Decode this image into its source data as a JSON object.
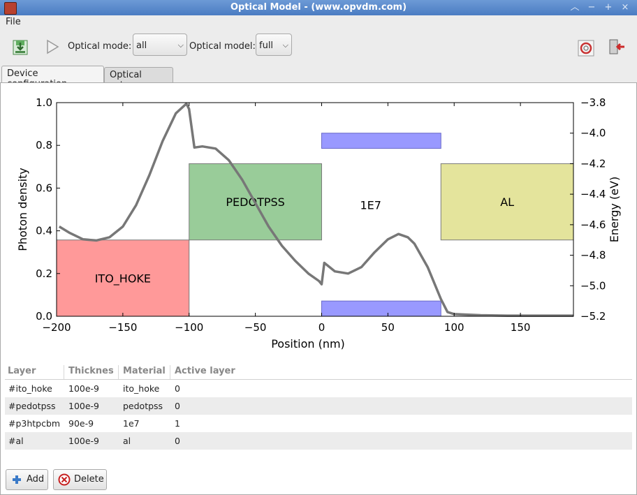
{
  "window": {
    "title": "Optical Model - (www.opvdm.com)"
  },
  "menu": {
    "file": "File"
  },
  "toolbar": {
    "optical_mode_label": "Optical mode:",
    "optical_mode_value": "all",
    "optical_model_label": "Optical model:",
    "optical_model_value": "full"
  },
  "tabs": [
    "Device configuration",
    "Optical setup"
  ],
  "chart_data": {
    "type": "line",
    "xlabel": "Position (nm)",
    "ylabel": "Photon density",
    "y2label": "Energy (eV)",
    "xlim": [
      -200,
      190
    ],
    "ylim": [
      0,
      1.0
    ],
    "y2lim": [
      -5.2,
      -3.8
    ],
    "xticks": [
      -200,
      -150,
      -100,
      -50,
      0,
      50,
      100,
      150
    ],
    "xtick_labels": [
      "−200",
      "−150",
      "−100",
      "−50",
      "0",
      "50",
      "100",
      "150"
    ],
    "yticks": [
      0.0,
      0.2,
      0.4,
      0.6,
      0.8,
      1.0
    ],
    "ytick_labels": [
      "0.0",
      "0.2",
      "0.4",
      "0.6",
      "0.8",
      "1.0"
    ],
    "y2ticks": [
      -5.2,
      -5.0,
      -4.8,
      -4.6,
      -4.4,
      -4.2,
      -4.0,
      -3.8
    ],
    "y2tick_labels": [
      "−5.2",
      "−5.0",
      "−4.8",
      "−4.6",
      "−4.4",
      "−4.2",
      "−4.0",
      "−3.8"
    ],
    "layers": [
      {
        "name": "ITO_HOKE",
        "x0": -200,
        "x1": -100,
        "e_top": -4.7,
        "e_bottom": -5.2,
        "color": "#ff9999"
      },
      {
        "name": "PEDOTPSS",
        "x0": -100,
        "x1": 0,
        "e_top": -4.2,
        "e_bottom": -4.7,
        "color": "#99cc99"
      },
      {
        "name": "AL",
        "x0": 90,
        "x1": 190,
        "e_top": -4.2,
        "e_bottom": -4.7,
        "color": "#e4e49c"
      }
    ],
    "bands": [
      {
        "x0": 0,
        "x1": 90,
        "e_top": -4.0,
        "e_bottom": -4.1,
        "color": "#9999ff"
      },
      {
        "x0": 0,
        "x1": 90,
        "e_top": -5.1,
        "e_bottom": -5.2,
        "color": "#9999ff"
      }
    ],
    "active_label": {
      "text": "1E7",
      "x": 37,
      "e": -4.47
    },
    "series": [
      {
        "color": "#777777",
        "x": [
          -198,
          -190,
          -180,
          -170,
          -160,
          -150,
          -140,
          -130,
          -120,
          -110,
          -102,
          -100,
          -96,
          -90,
          -80,
          -70,
          -60,
          -50,
          -40,
          -30,
          -20,
          -10,
          -2,
          0,
          2,
          10,
          20,
          30,
          40,
          50,
          58,
          65,
          70,
          80,
          90,
          95,
          100,
          120,
          140,
          160,
          180,
          190
        ],
        "y": [
          0.42,
          0.39,
          0.36,
          0.355,
          0.37,
          0.42,
          0.52,
          0.66,
          0.82,
          0.95,
          0.995,
          0.97,
          0.79,
          0.795,
          0.785,
          0.73,
          0.64,
          0.53,
          0.42,
          0.33,
          0.26,
          0.2,
          0.165,
          0.15,
          0.25,
          0.21,
          0.2,
          0.23,
          0.3,
          0.36,
          0.385,
          0.37,
          0.34,
          0.23,
          0.08,
          0.02,
          0.01,
          0.005,
          0.003,
          0.003,
          0.003,
          0.003
        ]
      }
    ]
  },
  "table": {
    "headers": [
      "Layer",
      "Thicknes",
      "Material",
      "Active layer"
    ],
    "rows": [
      [
        "#ito_hoke",
        "100e-9",
        "ito_hoke",
        "0"
      ],
      [
        "#pedotpss",
        "100e-9",
        "pedotpss",
        "0"
      ],
      [
        "#p3htpcbm",
        "90e-9",
        "1e7",
        "1"
      ],
      [
        "#al",
        "100e-9",
        "al",
        "0"
      ]
    ]
  },
  "buttons": {
    "add": "Add",
    "delete": "Delete"
  }
}
